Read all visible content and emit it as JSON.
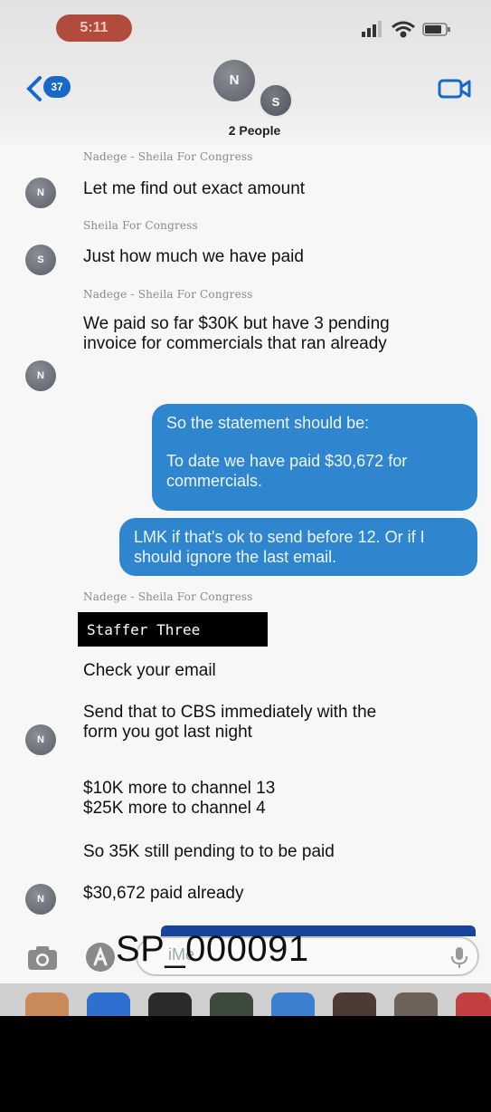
{
  "status": {
    "time": "5:11"
  },
  "header": {
    "back_count": "37",
    "avatar_n": "N",
    "avatar_s": "S",
    "people_label": "2 People"
  },
  "messages": [
    {
      "sender": "Nadege - Sheila For Congress",
      "text": "Let me find out exact amount",
      "avatar": "N"
    },
    {
      "sender": "Sheila For Congress",
      "text": "Just how much we have paid",
      "avatar": "S"
    },
    {
      "sender": "Nadege - Sheila For Congress",
      "text": "We paid so far $30K but have 3 pending invoice for commercials that ran already",
      "avatar": "N"
    }
  ],
  "outgoing": [
    {
      "line1": "So the statement should be:",
      "line2": "To date we have paid $30,672 for commercials."
    },
    {
      "text": "LMK if that's ok to send before 12. Or if I should ignore the last email."
    }
  ],
  "thread2": {
    "sender": "Nadege - Sheila For Congress",
    "redaction_label": "Staffer Three",
    "m1": "Check your email",
    "m2": "Send that to CBS immediately with the form you got last night",
    "m3a": "$10K more to channel 13",
    "m3b": "$25K more to channel 4",
    "m4": "So 35K still pending to to be paid",
    "m5": "$30,672 paid already",
    "avatar": "N"
  },
  "compose": {
    "placeholder": "iMe",
    "stamp": "SP_000091"
  },
  "colors": {
    "bubble": "#2f86cf",
    "accent": "#1868c7"
  }
}
